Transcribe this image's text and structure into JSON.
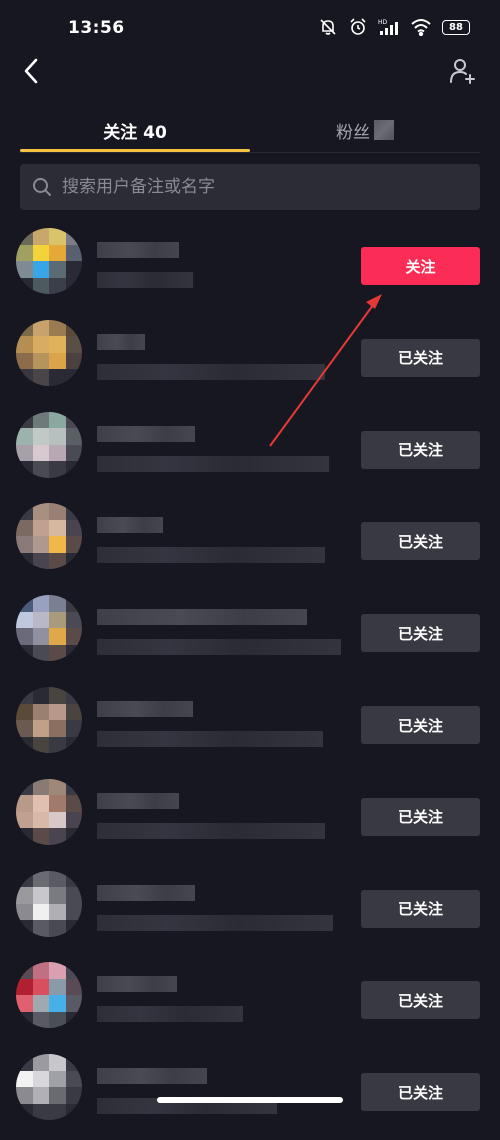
{
  "status_bar": {
    "time": "13:56",
    "battery": "88",
    "icons": [
      "mute-icon",
      "alarm-icon",
      "hd-signal-icon",
      "wifi-icon",
      "battery-icon"
    ]
  },
  "nav": {
    "back_icon": "chevron-left-icon",
    "add_friend_icon": "add-user-icon"
  },
  "tabs": {
    "following_label": "关注 40",
    "fans_label": "粉丝"
  },
  "search": {
    "placeholder": "搜索用户备注或名字"
  },
  "users": [
    {
      "button_label": "关注",
      "state": "not_following"
    },
    {
      "button_label": "已关注",
      "state": "following"
    },
    {
      "button_label": "已关注",
      "state": "following"
    },
    {
      "button_label": "已关注",
      "state": "following"
    },
    {
      "button_label": "已关注",
      "state": "following"
    },
    {
      "button_label": "已关注",
      "state": "following"
    },
    {
      "button_label": "已关注",
      "state": "following"
    },
    {
      "button_label": "已关注",
      "state": "following"
    },
    {
      "button_label": "已关注",
      "state": "following"
    },
    {
      "button_label": "已关注",
      "state": "following"
    }
  ],
  "colors": {
    "background": "#171721",
    "follow_button": "#fb2c55",
    "following_button": "#393943",
    "tab_underline": "#f5c242",
    "search_bg": "#2c2c36",
    "annotation_arrow": "#e53935"
  }
}
